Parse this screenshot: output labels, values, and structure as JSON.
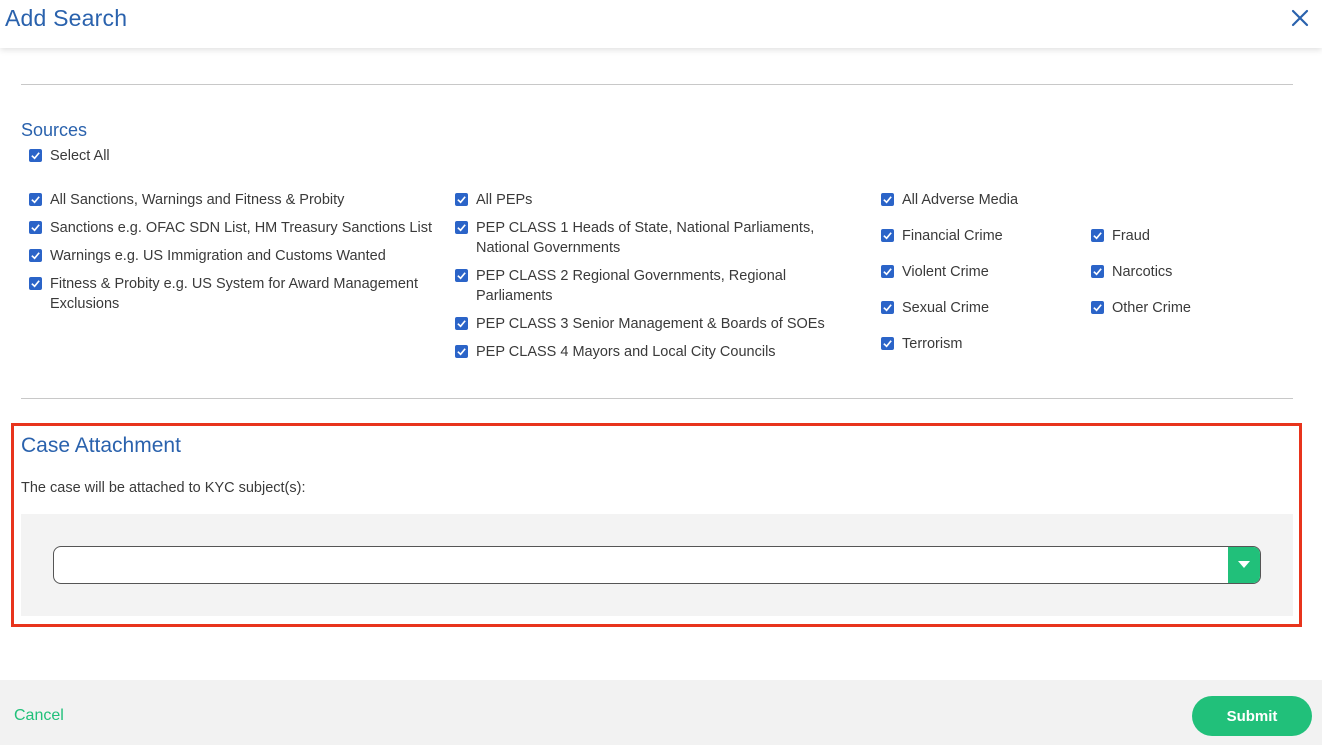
{
  "header": {
    "title": "Add  Search"
  },
  "sources": {
    "title": "Sources",
    "select_all": {
      "label": "Select All",
      "checked": true
    },
    "col1": [
      {
        "label": "All Sanctions, Warnings and Fitness & Probity",
        "checked": true
      },
      {
        "label": "Sanctions e.g. OFAC SDN List, HM Treasury Sanctions List",
        "checked": true
      },
      {
        "label": "Warnings e.g. US Immigration and Customs Wanted",
        "checked": true
      },
      {
        "label": "Fitness & Probity e.g. US System for Award Management Exclusions",
        "checked": true
      }
    ],
    "col2": [
      {
        "label": "All PEPs",
        "checked": true
      },
      {
        "label": "PEP CLASS 1 Heads of State, National Parliaments, National Governments",
        "checked": true
      },
      {
        "label": "PEP CLASS 2 Regional Governments, Regional Parliaments",
        "checked": true
      },
      {
        "label": "PEP CLASS 3 Senior Management & Boards of SOEs",
        "checked": true
      },
      {
        "label": "PEP CLASS 4 Mayors and Local City Councils",
        "checked": true
      }
    ],
    "col3": [
      {
        "label": "All Adverse Media",
        "checked": true
      },
      {
        "label": "Financial Crime",
        "checked": true
      },
      {
        "label": "Violent Crime",
        "checked": true
      },
      {
        "label": "Sexual Crime",
        "checked": true
      },
      {
        "label": "Terrorism",
        "checked": true
      }
    ],
    "col4": [
      {
        "label": "Fraud",
        "checked": true
      },
      {
        "label": "Narcotics",
        "checked": true
      },
      {
        "label": "Other Crime",
        "checked": true
      }
    ]
  },
  "case_attachment": {
    "title": "Case Attachment",
    "description": "The case will be attached to KYC subject(s):",
    "selected_value": ""
  },
  "footer": {
    "cancel_label": "Cancel",
    "submit_label": "Submit"
  },
  "colors": {
    "accent_blue": "#2a62ad",
    "checkbox_blue": "#2b64c8",
    "green": "#21c07a",
    "highlight_red": "#e8341c"
  }
}
